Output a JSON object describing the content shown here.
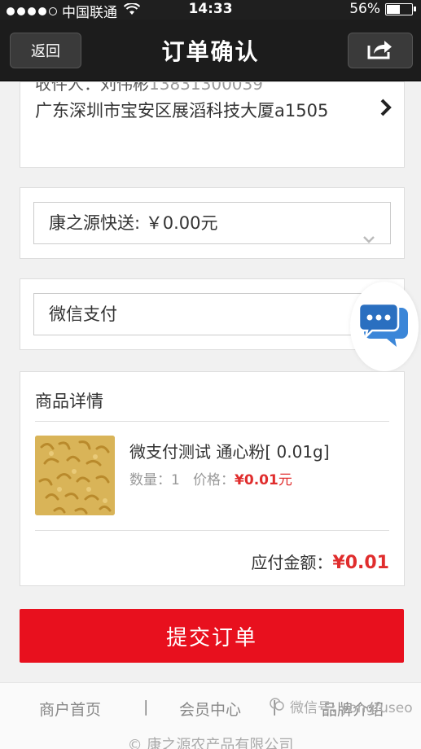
{
  "status_bar": {
    "carrier": "中国联通",
    "time": "14:33",
    "battery": "56%",
    "battery_level": 0.56
  },
  "nav": {
    "back_label": "返回",
    "title": "订单确认"
  },
  "address": {
    "recipient_partial": "收件人：刘伟彬",
    "phone_partial": "13831300039",
    "text": "广东深圳市宝安区展滔科技大厦a1505"
  },
  "shipping": {
    "value": "康之源快送: ￥0.00元"
  },
  "payment": {
    "value": "微信支付"
  },
  "goods": {
    "title": "商品详情",
    "product_name": "微支付测试 通心粉[ 0.01g]",
    "qty_label": "数量：1",
    "price_label": "价格：",
    "price_value": "¥0.01",
    "price_unit": "元",
    "total_label": "应付金额：",
    "total_value": "¥0.01"
  },
  "submit_label": "提交订单",
  "footer": {
    "links": [
      "商户首页",
      "会员中心",
      "品牌介绍"
    ],
    "separator": "|",
    "copyright": "© 康之源农产品有限公司"
  },
  "watermark": "微信号: yongfuseo",
  "colors": {
    "accent_red": "#e8101e",
    "price_red": "#e02d2d",
    "nav_bg": "#1c1c1c"
  }
}
